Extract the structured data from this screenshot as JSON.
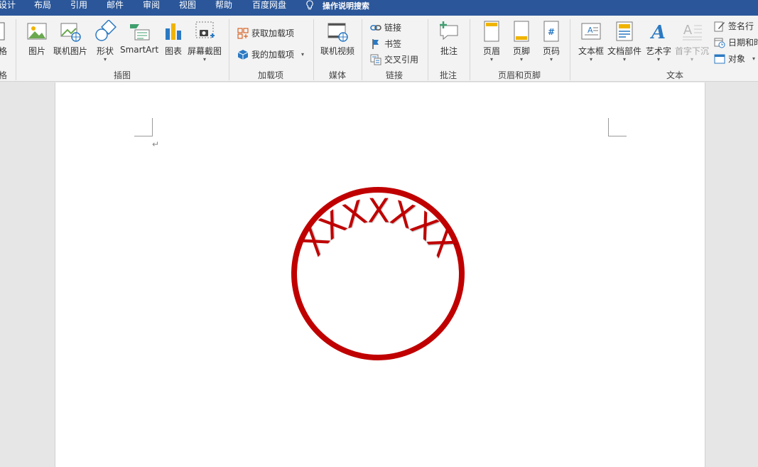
{
  "menu": {
    "tabs": [
      "设计",
      "布局",
      "引用",
      "邮件",
      "审阅",
      "视图",
      "帮助",
      "百度网盘"
    ],
    "tell_me": "操作说明搜索"
  },
  "ribbon": {
    "partial_label": "格",
    "partial_group": "格",
    "illustrations": {
      "group_label": "插图",
      "picture": "图片",
      "online_picture": "联机图片",
      "shapes": "形状",
      "smartart": "SmartArt",
      "chart": "图表",
      "screenshot": "屏幕截图"
    },
    "addins": {
      "group_label": "加载项",
      "get_addins": "获取加载项",
      "my_addins": "我的加载项"
    },
    "media": {
      "group_label": "媒体",
      "online_video": "联机视频"
    },
    "links": {
      "group_label": "链接",
      "link": "链接",
      "bookmark": "书签",
      "cross_ref": "交叉引用"
    },
    "comments": {
      "group_label": "批注",
      "comment": "批注"
    },
    "header_footer": {
      "group_label": "页眉和页脚",
      "header": "页眉",
      "footer": "页脚",
      "page_number": "页码"
    },
    "text": {
      "group_label": "文本",
      "textbox": "文本框",
      "quick_parts": "文档部件",
      "wordart": "艺术字",
      "drop_cap": "首字下沉",
      "signature_line": "签名行",
      "date_time": "日期和时",
      "object": "对象"
    }
  },
  "document": {
    "paragraph_mark": "↵",
    "seal": {
      "arc_text": "XXXXXXX",
      "color": "#c00000"
    }
  },
  "colors": {
    "title_bar": "#2b579a",
    "ribbon_bg": "#f3f3f3",
    "seal_red": "#c00000"
  }
}
